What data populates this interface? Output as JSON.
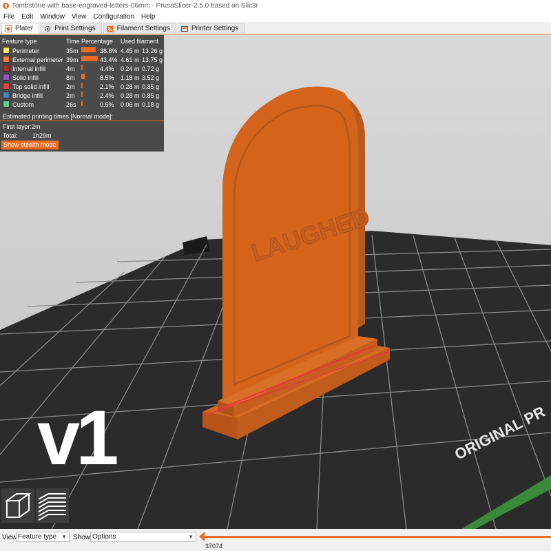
{
  "window": {
    "title": "Tombstone with base-engraved-letters-06mm - PrusaSlicer-2.5.0 based on Slic3r"
  },
  "menu": [
    "File",
    "Edit",
    "Window",
    "View",
    "Configuration",
    "Help"
  ],
  "tabs": [
    {
      "label": "Plater",
      "icon": "plater-icon",
      "active": true
    },
    {
      "label": "Print Settings",
      "icon": "gear-icon",
      "active": false
    },
    {
      "label": "Filament Settings",
      "icon": "spool-icon",
      "active": false
    },
    {
      "label": "Printer Settings",
      "icon": "printer-icon",
      "active": false
    }
  ],
  "legend": {
    "headers": {
      "feature": "Feature type",
      "time": "Time",
      "percentage": "Percentage",
      "filament": "Used filament"
    },
    "rows": [
      {
        "name": "Perimeter",
        "color": "#ffe65a",
        "time": "35m",
        "percent": 38.8,
        "percent_label": "38.8%",
        "length": "4.45 m",
        "weight": "13.26 g"
      },
      {
        "name": "External perimeter",
        "color": "#ff7d38",
        "time": "39m",
        "percent": 43.4,
        "percent_label": "43.4%",
        "length": "4.61 m",
        "weight": "13.75 g"
      },
      {
        "name": "Internal infill",
        "color": "#b03029",
        "time": "4m",
        "percent": 4.4,
        "percent_label": "4.4%",
        "length": "0.24 m",
        "weight": "0.72 g"
      },
      {
        "name": "Solid infill",
        "color": "#9654cc",
        "time": "8m",
        "percent": 8.5,
        "percent_label": "8.5%",
        "length": "1.18 m",
        "weight": "3.52 g"
      },
      {
        "name": "Top solid infill",
        "color": "#f04040",
        "time": "2m",
        "percent": 2.1,
        "percent_label": "2.1%",
        "length": "0.28 m",
        "weight": "0.85 g"
      },
      {
        "name": "Bridge infill",
        "color": "#4d80ba",
        "time": "2m",
        "percent": 2.4,
        "percent_label": "2.4%",
        "length": "0.28 m",
        "weight": "0.85 g"
      },
      {
        "name": "Custom",
        "color": "#5ed194",
        "time": "26s",
        "percent": 0.5,
        "percent_label": "0.5%",
        "length": "0.06 m",
        "weight": "0.18 g"
      }
    ],
    "estimated_label": "Estimated printing times [Normal mode]:",
    "first_layer_label": "First layer:",
    "first_layer_value": "2m",
    "total_label": "Total:",
    "total_value": "1h29m",
    "stealth_button": "Show stealth mode"
  },
  "scene": {
    "engraved_text": "LAUGHED",
    "bed_text": "ORIGINAL PR",
    "version_label": "v1",
    "model_color": "#d4641c",
    "accent": "#ed6b21"
  },
  "view_icons": [
    "iso-view-icon",
    "layers-view-icon"
  ],
  "bottombar": {
    "view_label": "View",
    "view_value": "Feature type",
    "show_label": "Show",
    "show_value": "Options",
    "slider_value": "37074"
  }
}
